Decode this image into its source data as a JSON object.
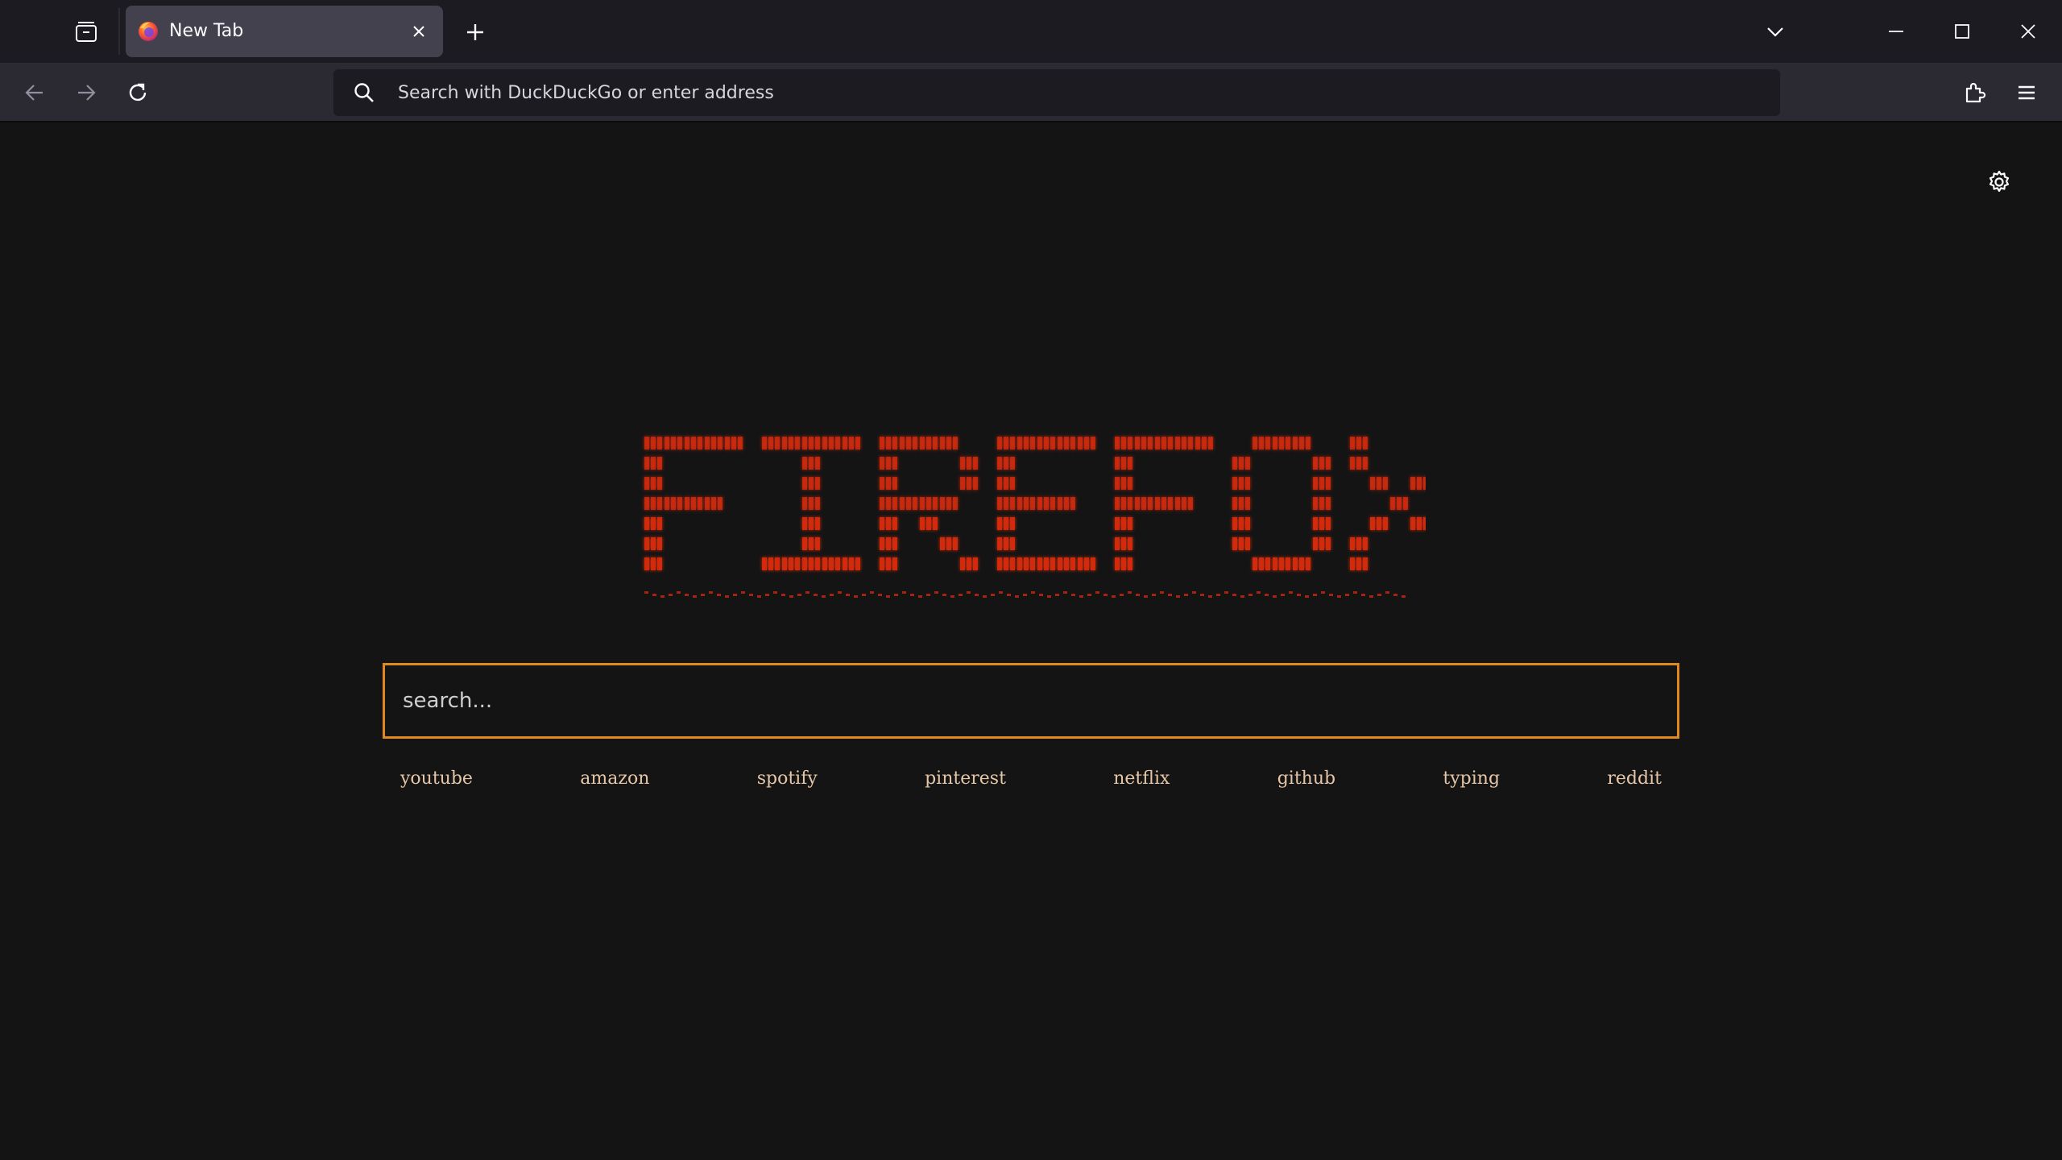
{
  "browser": {
    "tab": {
      "title": "New Tab",
      "favicon": "firefox-logo"
    },
    "urlbar": {
      "placeholder": "Search with DuckDuckGo or enter address",
      "value": ""
    },
    "icons": {
      "tab_list": "tab-list-icon",
      "close_tab": "close-icon",
      "new_tab": "plus-icon",
      "list_all_tabs": "chevron-down-icon",
      "minimize": "minimize-icon",
      "maximize": "maximize-icon",
      "close_window": "close-icon",
      "back": "arrow-left-icon",
      "forward": "arrow-right-icon",
      "reload": "reload-icon",
      "search": "search-icon",
      "extensions": "puzzle-icon",
      "menu": "hamburger-menu-icon"
    }
  },
  "page": {
    "logo_text": "FIREFOX",
    "search": {
      "placeholder": "search...",
      "value": ""
    },
    "quick_links": [
      {
        "label": "youtube"
      },
      {
        "label": "amazon"
      },
      {
        "label": "spotify"
      },
      {
        "label": "pinterest"
      },
      {
        "label": "netflix"
      },
      {
        "label": "github"
      },
      {
        "label": "typing"
      },
      {
        "label": "reddit"
      }
    ],
    "settings_icon": "gear-icon"
  },
  "colors": {
    "accent": "#e08a1e",
    "logo_red": "#d42a10",
    "link_color": "#e6c6a6",
    "background": "#141414"
  }
}
